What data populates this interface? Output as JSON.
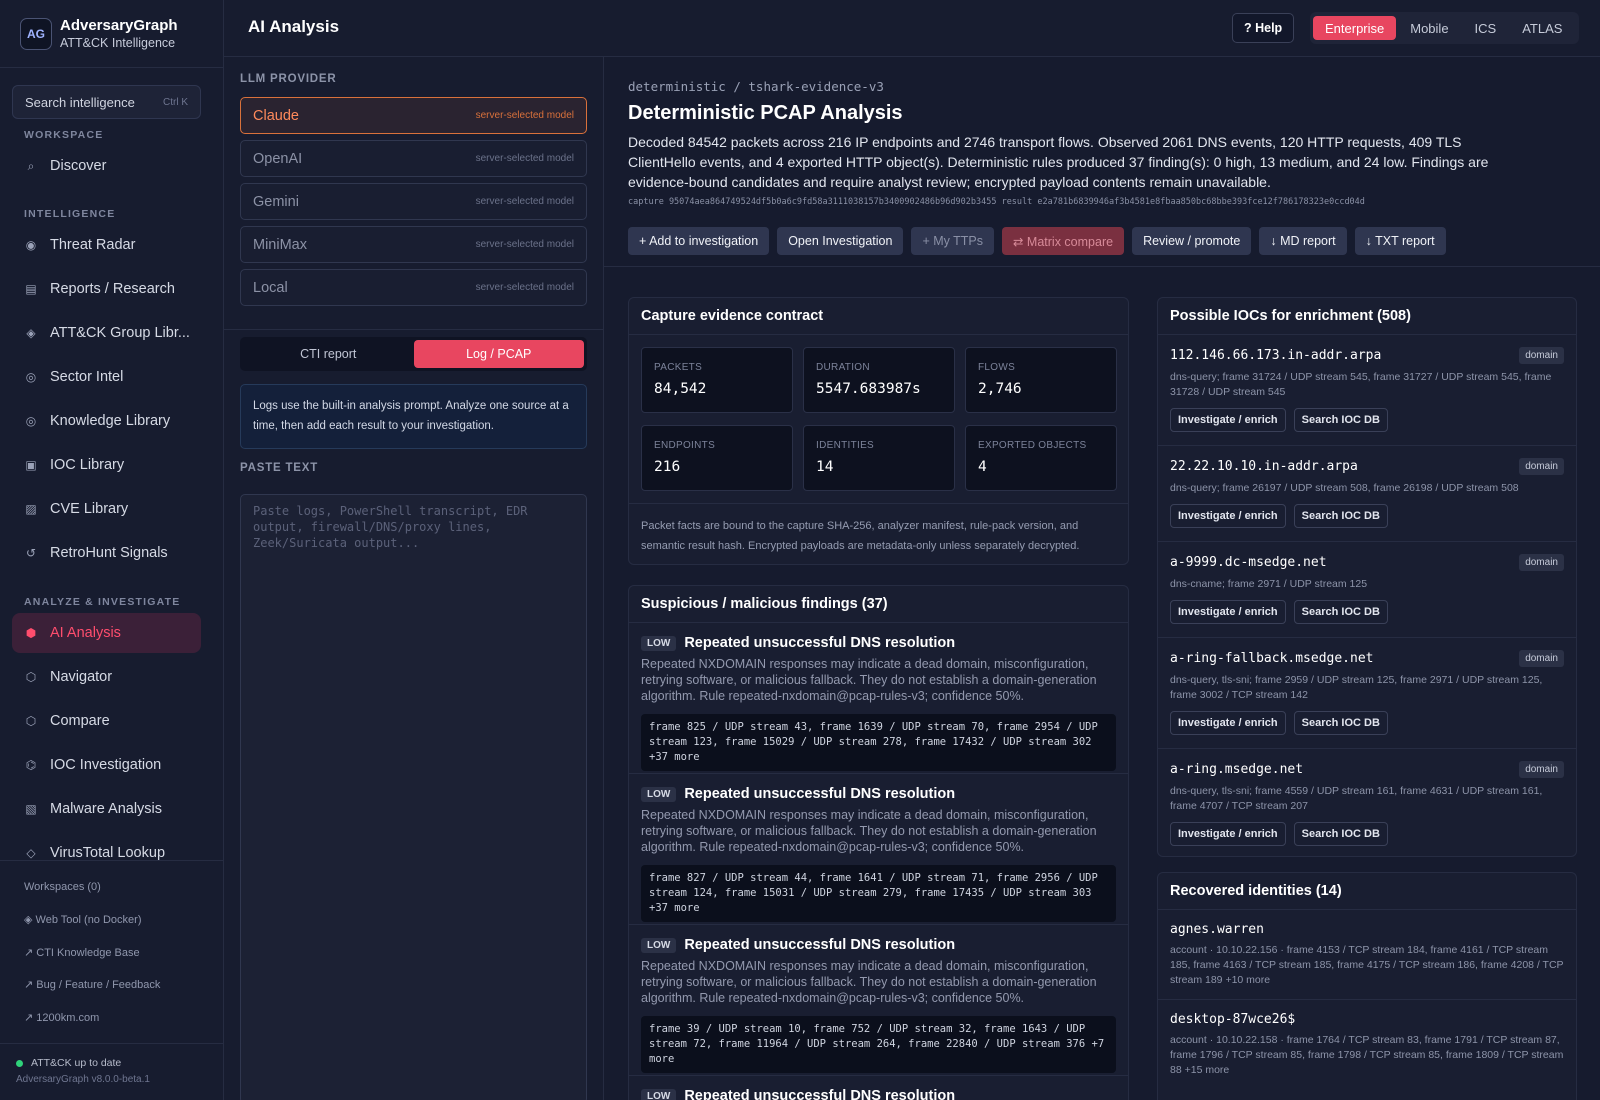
{
  "brand": {
    "logo_text": "AG",
    "name": "AdversaryGraph",
    "subtitle": "ATT&CK Intelligence"
  },
  "search": {
    "placeholder": "Search intelligence",
    "shortcut": "Ctrl K"
  },
  "sidebar": {
    "workspace_heading": "WORKSPACE",
    "workspace_items": [
      {
        "icon": "search-icon",
        "label": "Discover"
      }
    ],
    "intelligence_heading": "INTELLIGENCE",
    "intelligence_items": [
      {
        "icon": "radar-icon",
        "label": "Threat Radar"
      },
      {
        "icon": "report-icon",
        "label": "Reports / Research"
      },
      {
        "icon": "diamond-icon",
        "label": "ATT&CK Group Libr..."
      },
      {
        "icon": "target-icon",
        "label": "Sector Intel"
      },
      {
        "icon": "book-icon",
        "label": "Knowledge Library"
      },
      {
        "icon": "box-icon",
        "label": "IOC Library"
      },
      {
        "icon": "grid-icon",
        "label": "CVE Library"
      },
      {
        "icon": "refresh-icon",
        "label": "RetroHunt Signals"
      }
    ],
    "analyze_heading": "ANALYZE & INVESTIGATE",
    "analyze_items": [
      {
        "icon": "hexagon-icon",
        "label": "AI Analysis",
        "active": true
      },
      {
        "icon": "hexagon-icon",
        "label": "Navigator"
      },
      {
        "icon": "hexagon-icon",
        "label": "Compare"
      },
      {
        "icon": "hexagon-icon",
        "label": "IOC Investigation"
      },
      {
        "icon": "grid-icon",
        "label": "Malware Analysis"
      },
      {
        "icon": "diamond-icon",
        "label": "VirusTotal Lookup"
      }
    ],
    "workspaces": "Workspaces (0)",
    "links": [
      "◈ Web Tool (no Docker)",
      "↗ CTI Knowledge Base",
      "↗ Bug / Feature / Feedback",
      "↗ 1200km.com"
    ],
    "status": "ATT&CK up to date",
    "version": "AdversaryGraph v8.0.0-beta.1"
  },
  "header": {
    "title": "AI Analysis",
    "help": "? Help",
    "domain_tabs": [
      "Enterprise",
      "Mobile",
      "ICS",
      "ATLAS"
    ],
    "active_tab": "Enterprise"
  },
  "left_panel": {
    "provider_label": "LLM PROVIDER",
    "providers": [
      {
        "name": "Claude",
        "model": "server-selected model",
        "selected": true
      },
      {
        "name": "OpenAI",
        "model": "server-selected model"
      },
      {
        "name": "Gemini",
        "model": "server-selected model"
      },
      {
        "name": "MiniMax",
        "model": "server-selected model"
      },
      {
        "name": "Local",
        "model": "server-selected model"
      }
    ],
    "modes": [
      "CTI report",
      "Log / PCAP"
    ],
    "active_mode": "Log / PCAP",
    "info": "Logs use the built-in analysis prompt. Analyze one source at a time, then add each result to your investigation.",
    "paste_label": "PASTE TEXT",
    "paste_placeholder": "Paste logs, PowerShell transcript, EDR output, firewall/DNS/proxy lines, Zeek/Suricata output..."
  },
  "analysis": {
    "breadcrumb": "deterministic / tshark-evidence-v3",
    "title": "Deterministic PCAP Analysis",
    "description": "Decoded 84542 packets across 216 IP endpoints and 2746 transport flows. Observed 2061 DNS events, 120 HTTP requests, 409 TLS ClientHello events, and 4 exported HTTP object(s). Deterministic rules produced 37 finding(s): 0 high, 13 medium, and 24 low. Findings are evidence-bound candidates and require analyst review; encrypted payload contents remain unavailable.",
    "hashes": "capture 95074aea864749524df5b0a6c9fd58a3111038157b3400902486b96d902b3455  result e2a781b6839946af3b4581e8fbaa850bc68bbe393fce12f786178323e0ccd04d",
    "actions": [
      "+ Add to investigation",
      "Open Investigation",
      "+ My TTPs",
      "⇄ Matrix compare",
      "Review / promote",
      "↓ MD report",
      "↓ TXT report"
    ]
  },
  "contract": {
    "title": "Capture evidence contract",
    "stats": [
      {
        "label": "PACKETS",
        "value": "84,542"
      },
      {
        "label": "DURATION",
        "value": "5547.683987s"
      },
      {
        "label": "FLOWS",
        "value": "2,746"
      },
      {
        "label": "ENDPOINTS",
        "value": "216"
      },
      {
        "label": "IDENTITIES",
        "value": "14"
      },
      {
        "label": "EXPORTED OBJECTS",
        "value": "4"
      }
    ],
    "note": "Packet facts are bound to the capture SHA-256, analyzer manifest, rule-pack version, and semantic result hash. Encrypted payloads are metadata-only unless separately decrypted."
  },
  "findings": {
    "title": "Suspicious / malicious findings (37)",
    "items": [
      {
        "severity": "LOW",
        "title": "Repeated unsuccessful DNS resolution",
        "desc": "Repeated NXDOMAIN responses may indicate a dead domain, misconfiguration, retrying software, or malicious fallback. They do not establish a domain-generation algorithm. Rule repeated-nxdomain@pcap-rules-v3; confidence 50%.",
        "evidence": "frame 825 / UDP stream 43, frame 1639 / UDP stream 70, frame 2954 / UDP stream 123, frame 15029 / UDP stream 278, frame 17432 / UDP stream 302 +37 more"
      },
      {
        "severity": "LOW",
        "title": "Repeated unsuccessful DNS resolution",
        "desc": "Repeated NXDOMAIN responses may indicate a dead domain, misconfiguration, retrying software, or malicious fallback. They do not establish a domain-generation algorithm. Rule repeated-nxdomain@pcap-rules-v3; confidence 50%.",
        "evidence": "frame 827 / UDP stream 44, frame 1641 / UDP stream 71, frame 2956 / UDP stream 124, frame 15031 / UDP stream 279, frame 17435 / UDP stream 303 +37 more"
      },
      {
        "severity": "LOW",
        "title": "Repeated unsuccessful DNS resolution",
        "desc": "Repeated NXDOMAIN responses may indicate a dead domain, misconfiguration, retrying software, or malicious fallback. They do not establish a domain-generation algorithm. Rule repeated-nxdomain@pcap-rules-v3; confidence 50%.",
        "evidence": "frame 39 / UDP stream 10, frame 752 / UDP stream 32, frame 1643 / UDP stream 72, frame 11964 / UDP stream 264, frame 22840 / UDP stream 376 +7 more"
      },
      {
        "severity": "LOW",
        "title": "Repeated unsuccessful DNS resolution",
        "desc": "",
        "evidence": ""
      }
    ]
  },
  "iocs": {
    "title": "Possible IOCs for enrichment (508)",
    "btn_investigate": "Investigate / enrich",
    "btn_search": "Search IOC DB",
    "items": [
      {
        "value": "112.146.66.173.in-addr.arpa",
        "type": "domain",
        "desc": "dns-query; frame 31724 / UDP stream 545, frame 31727 / UDP stream 545, frame 31728 / UDP stream 545"
      },
      {
        "value": "22.22.10.10.in-addr.arpa",
        "type": "domain",
        "desc": "dns-query; frame 26197 / UDP stream 508, frame 26198 / UDP stream 508"
      },
      {
        "value": "a-9999.dc-msedge.net",
        "type": "domain",
        "desc": "dns-cname; frame 2971 / UDP stream 125"
      },
      {
        "value": "a-ring-fallback.msedge.net",
        "type": "domain",
        "desc": "dns-query, tls-sni; frame 2959 / UDP stream 125, frame 2971 / UDP stream 125, frame 3002 / TCP stream 142"
      },
      {
        "value": "a-ring.msedge.net",
        "type": "domain",
        "desc": "dns-query, tls-sni; frame 4559 / UDP stream 161, frame 4631 / UDP stream 161, frame 4707 / TCP stream 207"
      }
    ]
  },
  "identities": {
    "title": "Recovered identities (14)",
    "items": [
      {
        "name": "agnes.warren",
        "desc": "account · 10.10.22.156 · frame 4153 / TCP stream 184, frame 4161 / TCP stream 185, frame 4163 / TCP stream 185, frame 4175 / TCP stream 186, frame 4208 / TCP stream 189 +10 more"
      },
      {
        "name": "desktop-87wce26$",
        "desc": "account · 10.10.22.158 · frame 1764 / TCP stream 83, frame 1791 / TCP stream 87, frame 1796 / TCP stream 85, frame 1798 / TCP stream 85, frame 1809 / TCP stream 88 +15 more"
      }
    ]
  },
  "colors": {
    "accent": "#e84660",
    "provider_selected": "#d9713b",
    "status_ok": "#2fd37a"
  }
}
